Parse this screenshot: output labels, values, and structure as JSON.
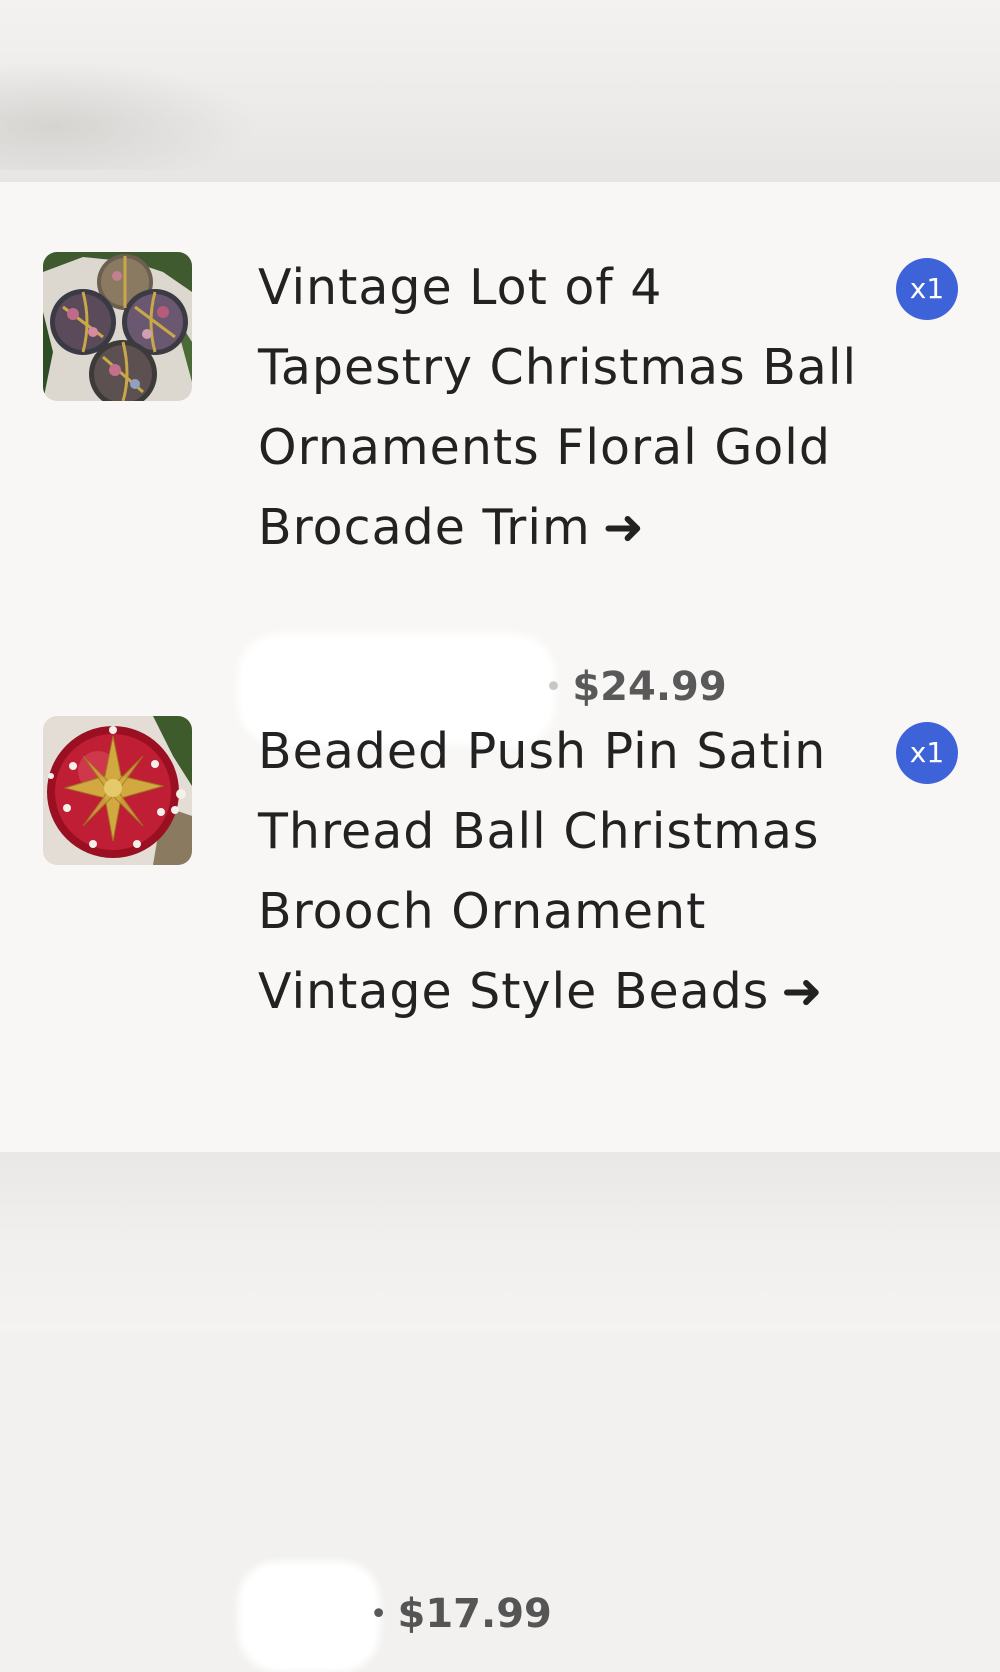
{
  "items": [
    {
      "title": "Vintage Lot of 4 Tapestry Christmas Ball Ornaments Floral Gold Brocade Trim",
      "arrow": "➜",
      "seller": "",
      "separator": "•",
      "price": "$24.99",
      "quantity": "x1",
      "thumbnail": "tapestry-ornaments-photo"
    },
    {
      "title": "Beaded Push Pin Satin Thread Ball Christmas Brooch Ornament Vintage Style Beads",
      "arrow": "➜",
      "seller": "",
      "separator": "•",
      "price": "$17.99",
      "quantity": "x1",
      "thumbnail": "red-satin-ornament-photo"
    }
  ],
  "colors": {
    "badge": "#3e63d8",
    "text": "#222222",
    "price": "#595959",
    "card_background": "#f8f7f5"
  }
}
